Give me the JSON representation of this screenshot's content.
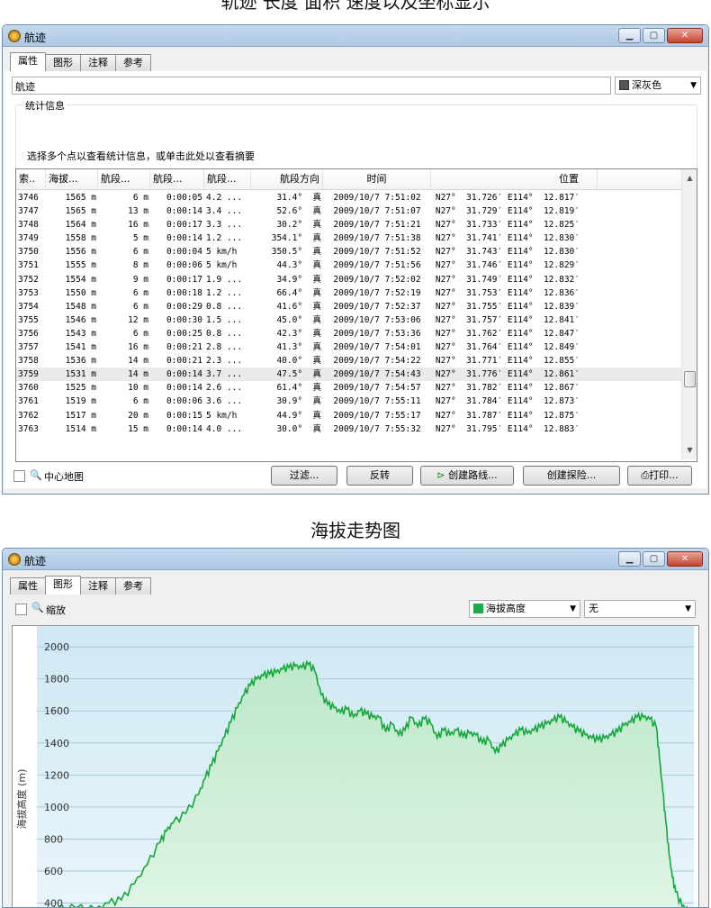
{
  "caption_top": "轨迹  长度  面积  速度以及坐标显示",
  "caption_mid": "海拔走势图",
  "window1": {
    "title": "航迹",
    "tabs": [
      "属性",
      "图形",
      "注释",
      "参考"
    ],
    "name_value": "航迹",
    "color_label": "深灰色",
    "group_legend": "统计信息",
    "group_text": "选择多个点以查看统计信息，或单击此处以查看摘要",
    "columns": [
      "索..",
      "海拔...",
      "航段...",
      "航段...",
      "航段...",
      "航段方向",
      "时间",
      "位置"
    ],
    "rows": [
      [
        "3746",
        "1565 m",
        "6 m",
        "0:00:05",
        "4.2 ...",
        "31.4°  真",
        "2009/10/7 7:51:02",
        "N27°  31.726′ E114°  12.817′"
      ],
      [
        "3747",
        "1565 m",
        "13 m",
        "0:00:14",
        "3.4 ...",
        "52.6°  真",
        "2009/10/7 7:51:07",
        "N27°  31.729′ E114°  12.819′"
      ],
      [
        "3748",
        "1564 m",
        "16 m",
        "0:00:17",
        "3.3 ...",
        "30.2°  真",
        "2009/10/7 7:51:21",
        "N27°  31.733′ E114°  12.825′"
      ],
      [
        "3749",
        "1558 m",
        "5 m",
        "0:00:14",
        "1.2 ...",
        "354.1°  真",
        "2009/10/7 7:51:38",
        "N27°  31.741′ E114°  12.830′"
      ],
      [
        "3750",
        "1556 m",
        "6 m",
        "0:00:04",
        "5 km/h",
        "350.5°  真",
        "2009/10/7 7:51:52",
        "N27°  31.743′ E114°  12.830′"
      ],
      [
        "3751",
        "1555 m",
        "8 m",
        "0:00:06",
        "5 km/h",
        "44.3°  真",
        "2009/10/7 7:51:56",
        "N27°  31.746′ E114°  12.829′"
      ],
      [
        "3752",
        "1554 m",
        "9 m",
        "0:00:17",
        "1.9 ...",
        "34.9°  真",
        "2009/10/7 7:52:02",
        "N27°  31.749′ E114°  12.832′"
      ],
      [
        "3753",
        "1550 m",
        "6 m",
        "0:00:18",
        "1.2 ...",
        "66.4°  真",
        "2009/10/7 7:52:19",
        "N27°  31.753′ E114°  12.836′"
      ],
      [
        "3754",
        "1548 m",
        "6 m",
        "0:00:29",
        "0.8 ...",
        "41.6°  真",
        "2009/10/7 7:52:37",
        "N27°  31.755′ E114°  12.839′"
      ],
      [
        "3755",
        "1546 m",
        "12 m",
        "0:00:30",
        "1.5 ...",
        "45.0°  真",
        "2009/10/7 7:53:06",
        "N27°  31.757′ E114°  12.841′"
      ],
      [
        "3756",
        "1543 m",
        "6 m",
        "0:00:25",
        "0.8 ...",
        "42.3°  真",
        "2009/10/7 7:53:36",
        "N27°  31.762′ E114°  12.847′"
      ],
      [
        "3757",
        "1541 m",
        "16 m",
        "0:00:21",
        "2.8 ...",
        "41.3°  真",
        "2009/10/7 7:54:01",
        "N27°  31.764′ E114°  12.849′"
      ],
      [
        "3758",
        "1536 m",
        "14 m",
        "0:00:21",
        "2.3 ...",
        "40.0°  真",
        "2009/10/7 7:54:22",
        "N27°  31.771′ E114°  12.855′"
      ],
      [
        "3759",
        "1531 m",
        "14 m",
        "0:00:14",
        "3.7 ...",
        "47.5°  真",
        "2009/10/7 7:54:43",
        "N27°  31.776′ E114°  12.861′"
      ],
      [
        "3760",
        "1525 m",
        "10 m",
        "0:00:14",
        "2.6 ...",
        "61.4°  真",
        "2009/10/7 7:54:57",
        "N27°  31.782′ E114°  12.867′"
      ],
      [
        "3761",
        "1519 m",
        "6 m",
        "0:00:06",
        "3.6 ...",
        "30.9°  真",
        "2009/10/7 7:55:11",
        "N27°  31.784′ E114°  12.873′"
      ],
      [
        "3762",
        "1517 m",
        "20 m",
        "0:00:15",
        "5 km/h",
        "44.9°  真",
        "2009/10/7 7:55:17",
        "N27°  31.787′ E114°  12.875′"
      ],
      [
        "3763",
        "1514 m",
        "15 m",
        "0:00:14",
        "4.0 ...",
        "30.0°  真",
        "2009/10/7 7:55:32",
        "N27°  31.795′ E114°  12.883′"
      ]
    ],
    "selected_row": 13,
    "center_map_label": "中心地图",
    "buttons": {
      "filter": "过滤...",
      "reverse": "反转",
      "create_route": "创建路线...",
      "create_adventure": "创建探险...",
      "print": "打印..."
    }
  },
  "window2": {
    "title": "航迹",
    "tabs": [
      "属性",
      "图形",
      "注释",
      "参考"
    ],
    "zoom_label": "缩放",
    "profile_select": "海拔高度",
    "second_select": "无"
  },
  "chart_data": {
    "type": "area",
    "ylabel": "海拔高度 (m)",
    "yticks": [
      400,
      600,
      800,
      1000,
      1200,
      1400,
      1600,
      1800,
      2000
    ],
    "ylim": [
      330,
      2130
    ],
    "grid": true,
    "x": [
      0,
      0.02,
      0.05,
      0.08,
      0.1,
      0.12,
      0.14,
      0.16,
      0.18,
      0.19,
      0.2,
      0.22,
      0.24,
      0.25,
      0.26,
      0.27,
      0.28,
      0.29,
      0.3,
      0.31,
      0.32,
      0.33,
      0.34,
      0.35,
      0.36,
      0.37,
      0.38,
      0.39,
      0.4,
      0.41,
      0.42,
      0.43,
      0.44,
      0.45,
      0.46,
      0.47,
      0.48,
      0.49,
      0.5,
      0.51,
      0.52,
      0.53,
      0.54,
      0.55,
      0.56,
      0.57,
      0.58,
      0.59,
      0.6,
      0.61,
      0.62,
      0.63,
      0.64,
      0.65,
      0.66,
      0.67,
      0.68,
      0.69,
      0.7,
      0.71,
      0.72,
      0.73,
      0.74,
      0.75,
      0.76,
      0.77,
      0.78,
      0.79,
      0.8,
      0.81,
      0.82,
      0.83,
      0.84,
      0.85,
      0.86,
      0.87,
      0.88,
      0.89,
      0.9,
      0.91,
      0.92,
      0.93,
      0.94,
      0.95,
      0.955,
      0.96,
      0.965,
      0.97,
      0.975,
      0.98,
      0.99,
      1.0
    ],
    "y": [
      360,
      365,
      370,
      360,
      400,
      420,
      520,
      640,
      780,
      850,
      900,
      960,
      1080,
      1180,
      1260,
      1350,
      1440,
      1530,
      1620,
      1700,
      1760,
      1800,
      1820,
      1830,
      1840,
      1860,
      1870,
      1880,
      1870,
      1890,
      1850,
      1700,
      1640,
      1620,
      1590,
      1610,
      1560,
      1600,
      1580,
      1560,
      1560,
      1470,
      1520,
      1450,
      1480,
      1560,
      1500,
      1550,
      1520,
      1430,
      1480,
      1450,
      1480,
      1440,
      1460,
      1450,
      1400,
      1420,
      1340,
      1380,
      1420,
      1450,
      1480,
      1460,
      1480,
      1500,
      1520,
      1540,
      1560,
      1530,
      1500,
      1470,
      1450,
      1430,
      1420,
      1430,
      1450,
      1470,
      1510,
      1530,
      1560,
      1560,
      1550,
      1500,
      1300,
      1100,
      900,
      700,
      560,
      470,
      380,
      360
    ]
  }
}
